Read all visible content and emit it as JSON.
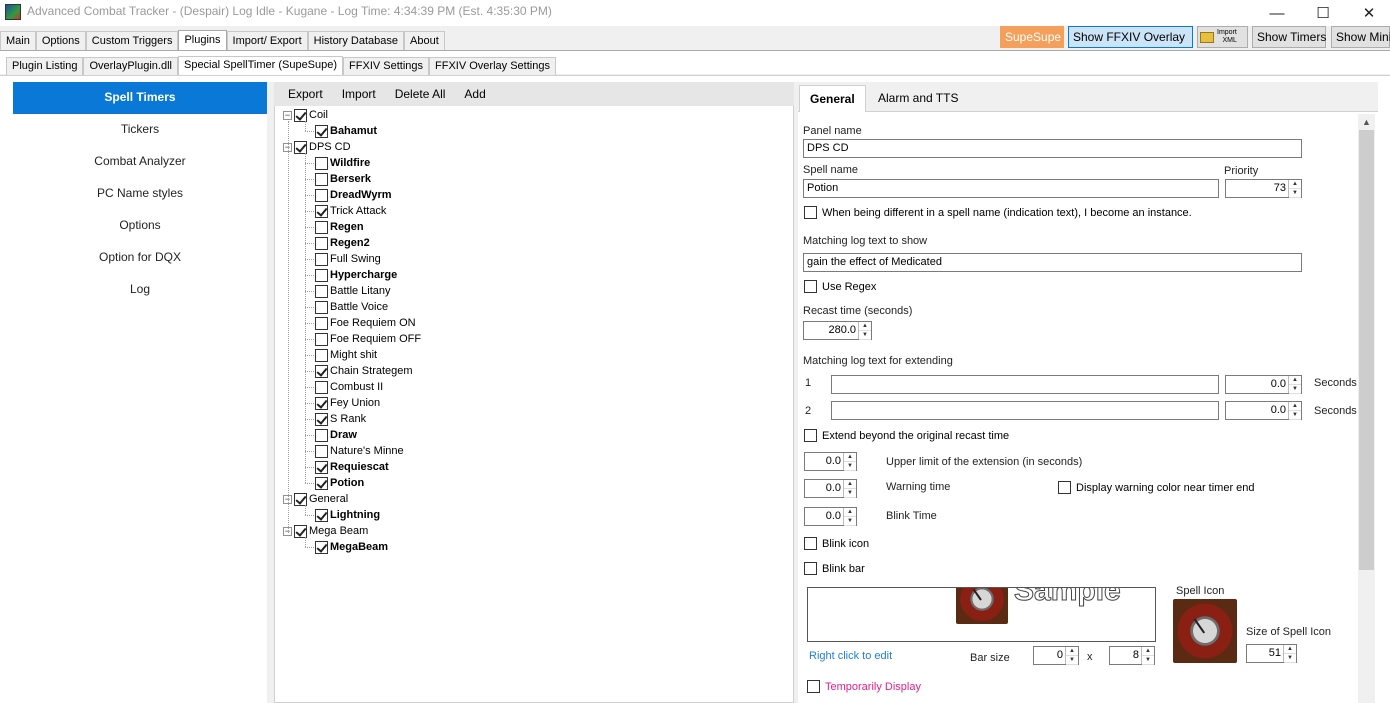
{
  "window": {
    "title": "Advanced Combat Tracker - (Despair) Log Idle - Kugane - Log Time: 4:34:39 PM (Est. 4:35:30 PM)",
    "controls": {
      "minimize": "—",
      "maximize": "☐",
      "close": "✕"
    }
  },
  "main_tabs": [
    "Main",
    "Options",
    "Custom Triggers",
    "Plugins",
    "Import/ Export",
    "History Database",
    "About"
  ],
  "top_buttons": {
    "supesupe": "SupeSupe",
    "show_ffxiv_overlay": "Show FFXIV Overlay",
    "import_xml_line1": "Import",
    "import_xml_line2": "XML",
    "show_timers": "Show Timers",
    "show_mini": "Show Mini"
  },
  "sub_tabs": [
    "Plugin Listing",
    "OverlayPlugin.dll",
    "Special SpellTimer (SupeSupe)",
    "FFXIV Settings",
    "FFXIV Overlay Settings"
  ],
  "left_nav": [
    "Spell Timers",
    "Tickers",
    "Combat Analyzer",
    "PC Name styles",
    "Options",
    "Option for DQX",
    "Log"
  ],
  "tree_toolbar": [
    "Export",
    "Import",
    "Delete All",
    "Add"
  ],
  "tree": {
    "coil": {
      "label": "Coil",
      "children": [
        {
          "label": "Bahamut",
          "checked": true,
          "bold": true
        }
      ]
    },
    "dps_cd": {
      "label": "DPS CD",
      "children": [
        {
          "label": "Wildfire",
          "checked": false,
          "bold": true
        },
        {
          "label": "Berserk",
          "checked": false,
          "bold": true
        },
        {
          "label": "DreadWyrm",
          "checked": false,
          "bold": true
        },
        {
          "label": "Trick Attack",
          "checked": true,
          "bold": false
        },
        {
          "label": "Regen",
          "checked": false,
          "bold": true
        },
        {
          "label": "Regen2",
          "checked": false,
          "bold": true
        },
        {
          "label": "Full Swing",
          "checked": false,
          "bold": false
        },
        {
          "label": "Hypercharge",
          "checked": false,
          "bold": true
        },
        {
          "label": "Battle Litany",
          "checked": false,
          "bold": false
        },
        {
          "label": "Battle Voice",
          "checked": false,
          "bold": false
        },
        {
          "label": "Foe Requiem ON",
          "checked": false,
          "bold": false
        },
        {
          "label": "Foe Requiem OFF",
          "checked": false,
          "bold": false
        },
        {
          "label": "Might shit",
          "checked": false,
          "bold": false
        },
        {
          "label": "Chain Strategem",
          "checked": true,
          "bold": false
        },
        {
          "label": "Combust II",
          "checked": false,
          "bold": false
        },
        {
          "label": "Fey Union",
          "checked": true,
          "bold": false
        },
        {
          "label": "S Rank",
          "checked": true,
          "bold": false
        },
        {
          "label": "Draw",
          "checked": false,
          "bold": true
        },
        {
          "label": "Nature's Minne",
          "checked": false,
          "bold": false
        },
        {
          "label": "Requiescat",
          "checked": true,
          "bold": true
        },
        {
          "label": "Potion",
          "checked": true,
          "bold": true
        }
      ]
    },
    "general": {
      "label": "General",
      "children": [
        {
          "label": "Lightning",
          "checked": true,
          "bold": true
        }
      ]
    },
    "mega_beam": {
      "label": "Mega Beam",
      "children": [
        {
          "label": "MegaBeam",
          "checked": true,
          "bold": true
        }
      ]
    }
  },
  "right_tabs": [
    "General",
    "Alarm and TTS"
  ],
  "form": {
    "panel_name_label": "Panel name",
    "panel_name_value": "DPS CD",
    "spell_name_label": "Spell name",
    "spell_name_value": "Potion",
    "priority_label": "Priority",
    "priority_value": "73",
    "instance_check_label": "When being different in a spell name (indication text), I become an instance.",
    "matching_log_label": "Matching log text to show",
    "matching_log_value": "gain the effect of Medicated",
    "use_regex_label": "Use Regex",
    "recast_label": "Recast time (seconds)",
    "recast_value": "280.0",
    "extend_label": "Matching log text for extending",
    "extend_rows": [
      {
        "index": "1",
        "text": "",
        "seconds": "0.0",
        "unit": "Seconds"
      },
      {
        "index": "2",
        "text": "",
        "seconds": "0.0",
        "unit": "Seconds"
      }
    ],
    "extend_beyond_label": "Extend beyond the original recast time",
    "upper_limit_value": "0.0",
    "upper_limit_label": "Upper limit of the extension (in seconds)",
    "warning_time_value": "0.0",
    "warning_time_label": "Warning time",
    "warning_color_label": "Display warning color near timer end",
    "blink_time_value": "0.0",
    "blink_time_label": "Blink Time",
    "blink_icon_label": "Blink icon",
    "blink_bar_label": "Blink bar",
    "preview_sample_text": "Sample",
    "right_click_label": "Right click to edit",
    "bar_size_label": "Bar size",
    "bar_size_w": "0",
    "bar_size_x": "x",
    "bar_size_h": "8",
    "spell_icon_label": "Spell Icon",
    "icon_size_label": "Size of Spell Icon",
    "icon_size_value": "51",
    "temporarily_display_label": "Temporarily Display"
  },
  "colors": {
    "accent": "#0a78d7",
    "supesupe_bg": "#f5a05a",
    "overlay_btn_bg": "#cce4f7",
    "link": "#1e7fd8",
    "magenta": "#e0208a"
  }
}
